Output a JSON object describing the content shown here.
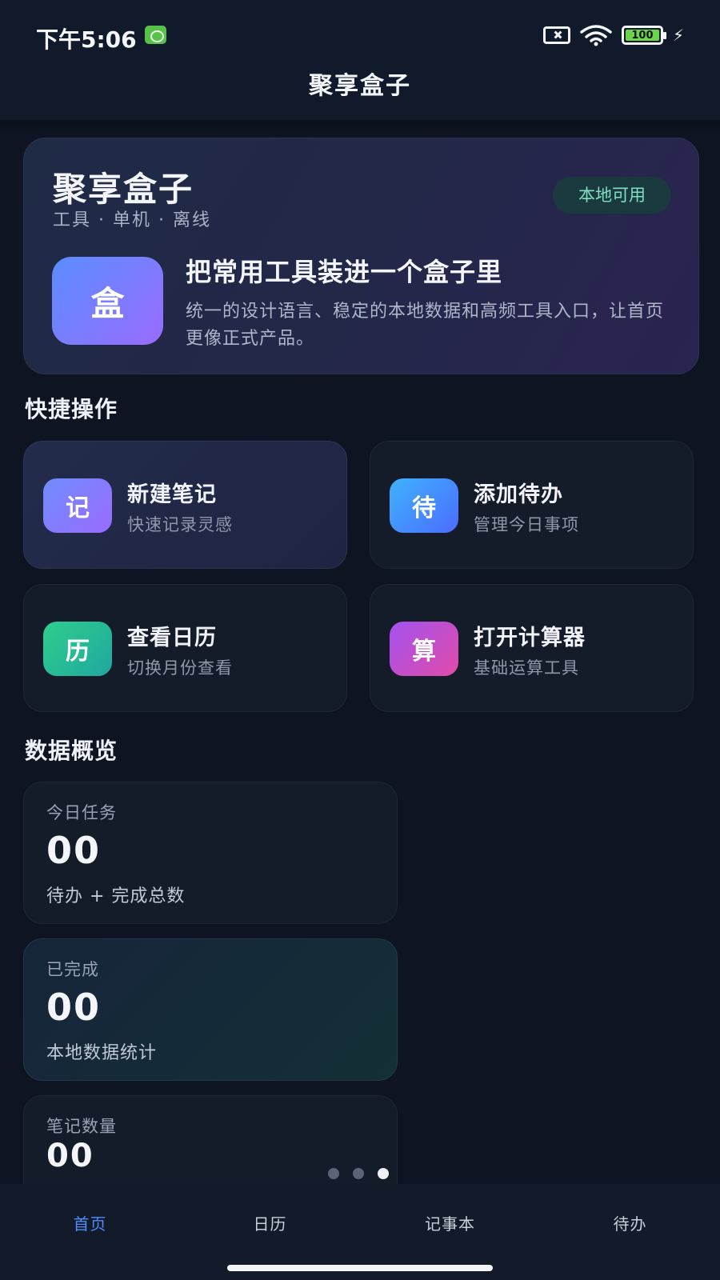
{
  "status_bar": {
    "time": "下午5:06",
    "battery": "100"
  },
  "header": {
    "title": "聚享盒子"
  },
  "hero": {
    "title": "聚享盒子",
    "tags": "工具 · 单机 · 离线",
    "badge": "本地可用",
    "logo_char": "盒",
    "headline": "把常用工具装进一个盒子里",
    "description": "统一的设计语言、稳定的本地数据和高频工具入口，让首页更像正式产品。"
  },
  "quick_actions": {
    "section_title": "快捷操作",
    "items": [
      {
        "icon_char": "记",
        "title": "新建笔记",
        "subtitle": "快速记录灵感",
        "color": "#8a6bff"
      },
      {
        "icon_char": "待",
        "title": "添加待办",
        "subtitle": "管理今日事项",
        "color": "#3d8bff"
      },
      {
        "icon_char": "历",
        "title": "查看日历",
        "subtitle": "切换月份查看",
        "color": "#23b98b"
      },
      {
        "icon_char": "算",
        "title": "打开计算器",
        "subtitle": "基础运算工具",
        "color": "#c74fd6"
      }
    ]
  },
  "overview": {
    "section_title": "数据概览",
    "stats": [
      {
        "label": "今日任务",
        "value": "00",
        "desc": "待办 + 完成总数"
      },
      {
        "label": "已完成",
        "value": "00",
        "desc": "本地数据统计"
      },
      {
        "label": "笔记数量",
        "value": "00",
        "desc": ""
      }
    ]
  },
  "pager": {
    "count": 3,
    "active_index": 2
  },
  "bottom_nav": {
    "items": [
      {
        "label": "首页"
      },
      {
        "label": "日历"
      },
      {
        "label": "记事本"
      },
      {
        "label": "待办"
      }
    ],
    "active_index": 0,
    "active_color": "#4d8dff"
  }
}
